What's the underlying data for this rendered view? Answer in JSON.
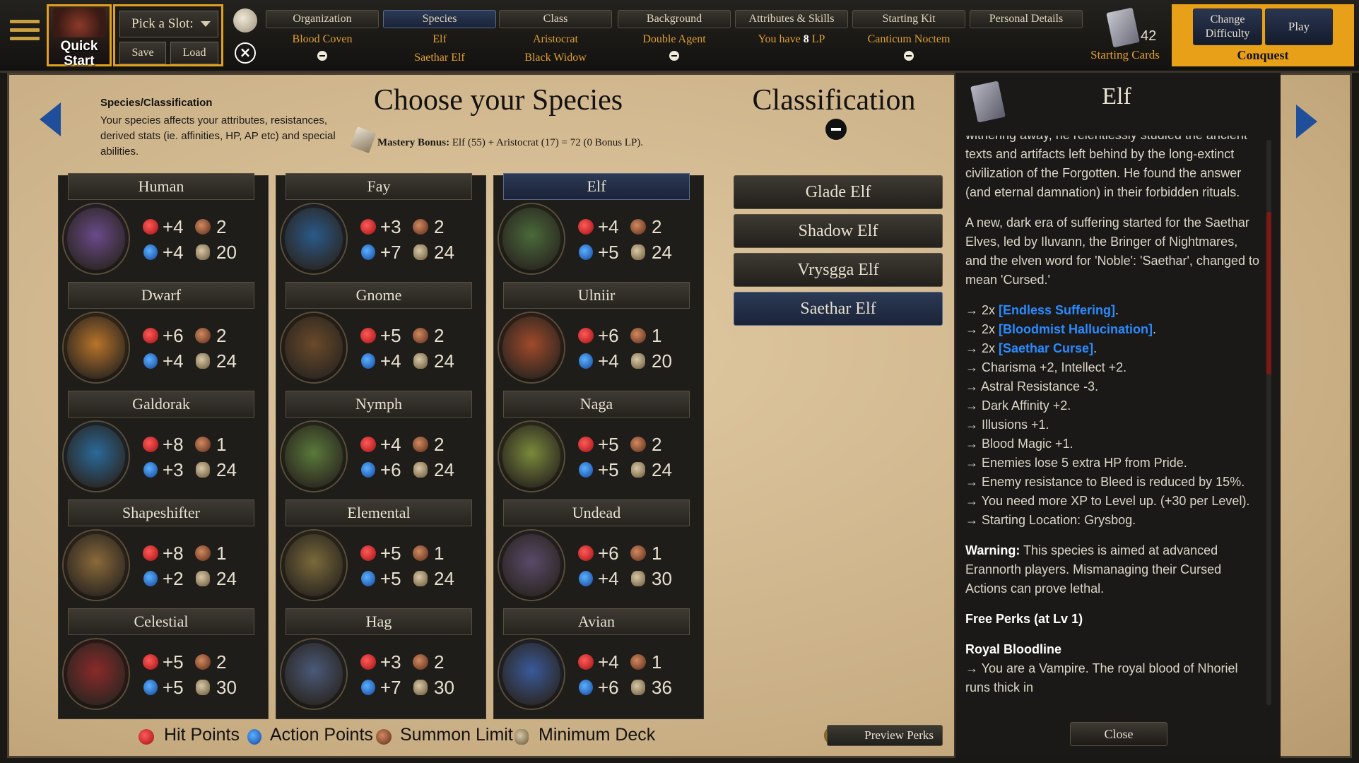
{
  "topbar": {
    "quick_start": "Quick Start",
    "slot_select": "Pick a Slot:",
    "save": "Save",
    "load": "Load",
    "tabs": [
      {
        "label": "Organization",
        "value": "Blood Coven",
        "value2": ""
      },
      {
        "label": "Species",
        "value": "Elf",
        "value2": "Saethar Elf"
      },
      {
        "label": "Class",
        "value": "Aristocrat",
        "value2": "Black Widow"
      },
      {
        "label": "Background",
        "value": "Double Agent",
        "value2": ""
      },
      {
        "label": "Attributes & Skills",
        "value_prefix": "You have ",
        "value_num": "8",
        "value_suffix": " LP",
        "value2": ""
      },
      {
        "label": "Starting Kit",
        "value": "Canticum Noctem",
        "value2": ""
      },
      {
        "label": "Personal Details",
        "value": "",
        "value2": ""
      }
    ],
    "starting_cards_count": "42",
    "starting_cards_label": "Starting Cards",
    "change_difficulty": "Change Difficulty",
    "play": "Play",
    "difficulty": "Conquest"
  },
  "info": {
    "title": "Species/Classification",
    "description": "Your species affects your attributes, resistances, derived stats (ie. affinities, HP, AP etc) and special abilities."
  },
  "page_title": "Choose your Species",
  "classification_title": "Classification",
  "mastery": {
    "label": "Mastery Bonus:",
    "text": "Elf (55) + Aristocrat (17) = 72 (0 Bonus LP)."
  },
  "species": [
    {
      "name": "Human",
      "hp": "+4",
      "summon": "2",
      "ap": "+4",
      "deck": "20",
      "color": "#6a4a8a"
    },
    {
      "name": "Dwarf",
      "hp": "+6",
      "summon": "2",
      "ap": "+4",
      "deck": "24",
      "color": "#b8742a"
    },
    {
      "name": "Galdorak",
      "hp": "+8",
      "summon": "1",
      "ap": "+3",
      "deck": "24",
      "color": "#2a6a9a"
    },
    {
      "name": "Shapeshifter",
      "hp": "+8",
      "summon": "1",
      "ap": "+2",
      "deck": "24",
      "color": "#8a6a3a"
    },
    {
      "name": "Celestial",
      "hp": "+5",
      "summon": "2",
      "ap": "+5",
      "deck": "30",
      "color": "#8a2a2a"
    },
    {
      "name": "Fay",
      "hp": "+3",
      "summon": "2",
      "ap": "+7",
      "deck": "24",
      "color": "#2a5a8a"
    },
    {
      "name": "Gnome",
      "hp": "+5",
      "summon": "2",
      "ap": "+4",
      "deck": "24",
      "color": "#6a4a2a"
    },
    {
      "name": "Nymph",
      "hp": "+4",
      "summon": "2",
      "ap": "+6",
      "deck": "24",
      "color": "#5a7a3a"
    },
    {
      "name": "Elemental",
      "hp": "+5",
      "summon": "1",
      "ap": "+5",
      "deck": "24",
      "color": "#7a6a3a"
    },
    {
      "name": "Hag",
      "hp": "+3",
      "summon": "2",
      "ap": "+7",
      "deck": "30",
      "color": "#4a5a7a"
    },
    {
      "name": "Elf",
      "hp": "+4",
      "summon": "2",
      "ap": "+5",
      "deck": "24",
      "color": "#4a6a3a"
    },
    {
      "name": "Ulniir",
      "hp": "+6",
      "summon": "1",
      "ap": "+4",
      "deck": "20",
      "color": "#a04a2a"
    },
    {
      "name": "Naga",
      "hp": "+5",
      "summon": "2",
      "ap": "+5",
      "deck": "24",
      "color": "#7a8a3a"
    },
    {
      "name": "Undead",
      "hp": "+6",
      "summon": "1",
      "ap": "+4",
      "deck": "30",
      "color": "#5a4a6a"
    },
    {
      "name": "Avian",
      "hp": "+4",
      "summon": "1",
      "ap": "+6",
      "deck": "36",
      "color": "#3a5a9a"
    }
  ],
  "classifications": [
    "Glade Elf",
    "Shadow Elf",
    "Vrysgga Elf",
    "Saethar Elf"
  ],
  "preview_perks": "Preview Perks",
  "legend": {
    "hp": "Hit Points",
    "ap": "Action Points",
    "summon": "Summon Limit",
    "deck": "Minimum Deck"
  },
  "detail": {
    "title": "Elf",
    "intro_cut": "withering away, he relentlessly studied the ancient",
    "para1": "texts and artifacts left behind by the long-extinct civilization of the Forgotten. He found the answer (and eternal damnation) in their forbidden rituals.",
    "para2": "A new, dark era of suffering started for the Saethar Elves, led by Iluvann, the Bringer of Nightmares, and the elven word for 'Noble': 'Saethar', changed to mean 'Cursed.'",
    "kw_items": [
      "[Endless Suffering]",
      "[Bloodmist Hallucination]",
      "[Saethar Curse]"
    ],
    "kw_prefix": "→ 2x ",
    "plain_items": [
      "→ Charisma +2, Intellect +2.",
      "→ Astral Resistance -3.",
      "→ Dark Affinity +2.",
      "→ Illusions +1.",
      "→ Blood Magic +1.",
      "→ Enemies lose 5 extra HP from Pride.",
      "→ Enemy resistance to Bleed is reduced by 15%.",
      "→ You need more XP to Level up. (+30 per Level).",
      "→ Starting Location: Grysbog."
    ],
    "warning_label": "Warning:",
    "warning_text": " This species is aimed at advanced Erannorth players. Mismanaging their Cursed Actions can prove lethal.",
    "free_perks": "Free Perks (at Lv 1)",
    "royal": "Royal Bloodline",
    "royal_text": "→ You are a Vampire. The royal blood of Nhoriel runs thick in",
    "close": "Close"
  }
}
